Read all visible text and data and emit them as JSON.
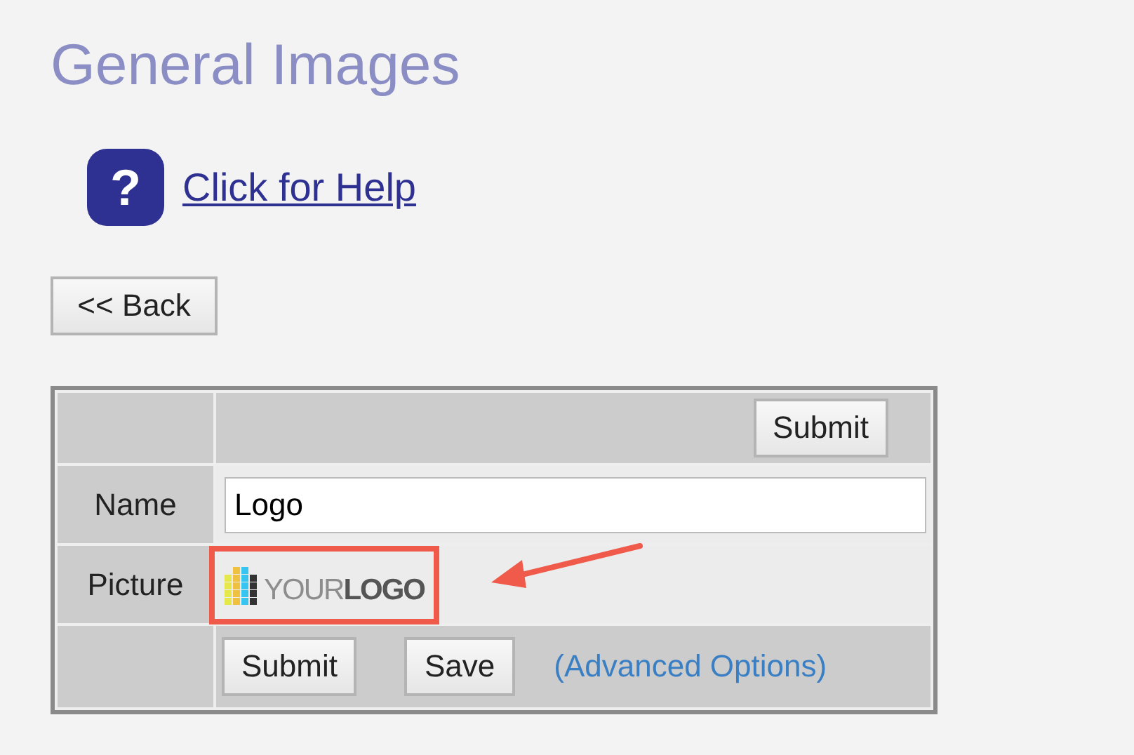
{
  "page": {
    "title": "General Images"
  },
  "help": {
    "icon": "?",
    "link": "Click for Help"
  },
  "back_button": "<< Back",
  "form": {
    "top_button": "Submit",
    "fields": [
      {
        "kind": "text",
        "label": "Name",
        "value": "Logo"
      },
      {
        "kind": "image",
        "label": "Picture",
        "logo_text": "YOUR**LOGO**",
        "highlighted": true
      }
    ],
    "buttons": [
      "Submit",
      "Save"
    ],
    "link": "(Advanced Options)"
  }
}
